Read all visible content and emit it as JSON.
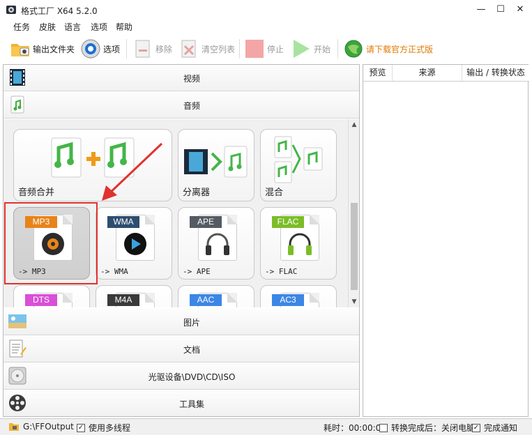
{
  "window": {
    "title": "格式工厂 X64 5.2.0"
  },
  "menu": [
    "任务",
    "皮肤",
    "语言",
    "选项",
    "帮助"
  ],
  "toolbar": {
    "output_folder": "输出文件夹",
    "options": "选项",
    "remove": "移除",
    "clear_list": "清空列表",
    "stop": "停止",
    "start": "开始",
    "download": "请下载官方正式版"
  },
  "categories": {
    "video": "视频",
    "audio": "音频",
    "image": "图片",
    "document": "文档",
    "rom": "光驱设备\\DVD\\CD\\ISO",
    "tools": "工具集"
  },
  "tiles": {
    "merge": "音频合并",
    "splitter": "分离器",
    "mix": "混合",
    "mp3_badge": "MP3",
    "mp3_label": "-> MP3",
    "wma_badge": "WMA",
    "wma_label": "-> WMA",
    "ape_badge": "APE",
    "ape_label": "-> APE",
    "flac_badge": "FLAC",
    "flac_label": "-> FLAC",
    "dts_badge": "DTS",
    "m4a_badge": "M4A",
    "aac_badge": "AAC",
    "ac3_badge": "AC3"
  },
  "task_list": {
    "columns": [
      "预览",
      "来源",
      "输出 / 转换状态"
    ]
  },
  "status": {
    "output_path": "G:\\FFOutput",
    "multithread": "使用多线程",
    "elapsed": "耗时：00:00:00",
    "after_convert": "转换完成后：关闭电脑",
    "notify": "完成通知",
    "multithread_checked": true,
    "after_convert_checked": false,
    "notify_checked": true
  },
  "colors": {
    "mp3": "#e8831a",
    "wma": "#2d4e6e",
    "ape": "#545b63",
    "flac": "#7bbd27",
    "dts": "#d94fd6",
    "m4a": "#3a3a3a",
    "aac": "#3c86e6",
    "ac3": "#3c86e6",
    "highlight": "#e0322e"
  }
}
